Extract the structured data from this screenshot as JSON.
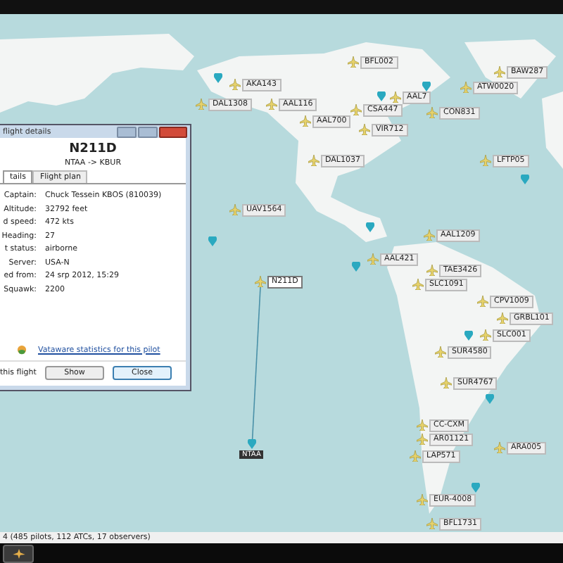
{
  "dialog": {
    "title": "flight details",
    "callsign": "N211D",
    "route": "NTAA -> KBUR",
    "tabs": [
      {
        "label": "tails",
        "selected": true
      },
      {
        "label": "Flight plan",
        "selected": false
      }
    ],
    "fields": [
      {
        "label": "Captain:",
        "value": "Chuck Tessein KBOS (810039)"
      },
      {
        "label": "Altitude:",
        "value": "32792 feet"
      },
      {
        "label": "d speed:",
        "value": "472 kts"
      },
      {
        "label": "Heading:",
        "value": "27"
      },
      {
        "label": "t status:",
        "value": "airborne"
      },
      {
        "label": "Server:",
        "value": "USA-N"
      },
      {
        "label": "ed from:",
        "value": "24 srp 2012, 15:29"
      },
      {
        "label": "Squawk:",
        "value": "2200"
      }
    ],
    "link": "Vataware statistics for this pilot",
    "footer_label": "this flight",
    "buttons": [
      {
        "label": "Show",
        "focused": false
      },
      {
        "label": "Close",
        "focused": true
      }
    ]
  },
  "map": {
    "flights": [
      {
        "callsign": "BFL002",
        "selected": false
      },
      {
        "callsign": "BAW287",
        "selected": false
      },
      {
        "callsign": "ATW0020",
        "selected": false
      },
      {
        "callsign": "AKA143",
        "selected": false
      },
      {
        "callsign": "DAL1308",
        "selected": false
      },
      {
        "callsign": "AAL116",
        "selected": false
      },
      {
        "callsign": "AAL7",
        "selected": false
      },
      {
        "callsign": "CSA447",
        "selected": false
      },
      {
        "callsign": "CON831",
        "selected": false
      },
      {
        "callsign": "AAL700",
        "selected": false
      },
      {
        "callsign": "VIR712",
        "selected": false
      },
      {
        "callsign": "DAL1037",
        "selected": false
      },
      {
        "callsign": "LFTP05",
        "selected": false
      },
      {
        "callsign": "UAV1564",
        "selected": false
      },
      {
        "callsign": "AAL1209",
        "selected": false
      },
      {
        "callsign": "AAL421",
        "selected": false
      },
      {
        "callsign": "TAE3426",
        "selected": false
      },
      {
        "callsign": "N211D",
        "selected": true
      },
      {
        "callsign": "SLC1091",
        "selected": false
      },
      {
        "callsign": "CPV1009",
        "selected": false
      },
      {
        "callsign": "GRBL101",
        "selected": false
      },
      {
        "callsign": "SLC001",
        "selected": false
      },
      {
        "callsign": "SUR4580",
        "selected": false
      },
      {
        "callsign": "SUR4767",
        "selected": false
      },
      {
        "callsign": "CC-CXM",
        "selected": false
      },
      {
        "callsign": "AR01121",
        "selected": false
      },
      {
        "callsign": "LAP571",
        "selected": false
      },
      {
        "callsign": "ARA005",
        "selected": false
      },
      {
        "callsign": "EUR-4008",
        "selected": false
      },
      {
        "callsign": "BFL1731",
        "selected": false
      }
    ],
    "airports": [
      {
        "code": "NTAA"
      }
    ]
  },
  "status_bar": {
    "text": "4 (485 pilots, 112 ATCs, 17 observers)"
  }
}
